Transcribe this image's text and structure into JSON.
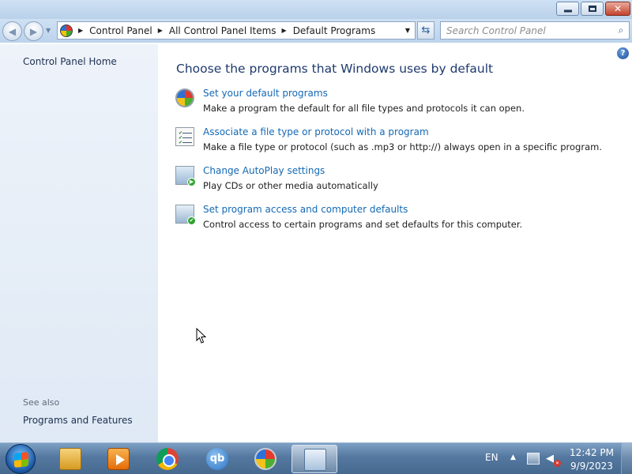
{
  "window": {
    "minimize_icon": "minimize-icon",
    "maximize_icon": "maximize-icon",
    "close_glyph": "✕"
  },
  "nav": {
    "breadcrumbs": [
      "Control Panel",
      "All Control Panel Items",
      "Default Programs"
    ],
    "search_placeholder": "Search Control Panel"
  },
  "sidebar": {
    "home_link": "Control Panel Home",
    "see_also": "See also",
    "programs_features": "Programs and Features"
  },
  "main": {
    "title": "Choose the programs that Windows uses by default",
    "help_glyph": "?",
    "tasks": [
      {
        "link": "Set your default programs",
        "desc": "Make a program the default for all file types and protocols it can open.",
        "icon": "default-programs-icon"
      },
      {
        "link": "Associate a file type or protocol with a program",
        "desc": "Make a file type or protocol (such as .mp3 or http://) always open in a specific program.",
        "icon": "file-association-icon"
      },
      {
        "link": "Change AutoPlay settings",
        "desc": "Play CDs or other media automatically",
        "icon": "autoplay-icon"
      },
      {
        "link": "Set program access and computer defaults",
        "desc": "Control access to certain programs and set defaults for this computer.",
        "icon": "program-access-icon"
      }
    ]
  },
  "taskbar": {
    "qb_label": "qb",
    "language": "EN",
    "time": "12:42 PM",
    "date": "9/9/2023",
    "apps": [
      "file-explorer-icon",
      "media-player-icon",
      "chrome-icon",
      "qbittorrent-icon",
      "default-programs-icon",
      "control-panel-icon"
    ]
  }
}
